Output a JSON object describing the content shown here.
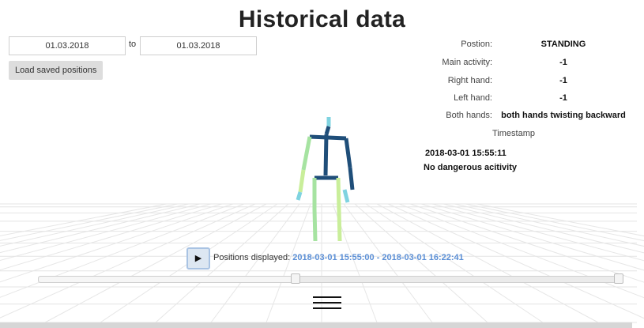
{
  "page": {
    "title": "Historical data"
  },
  "filters": {
    "date_from": "01.03.2018",
    "to_label": "to",
    "date_to": "01.03.2018",
    "load_button": "Load saved positions"
  },
  "info": {
    "rows": [
      {
        "label": "Postion:",
        "value": "STANDING"
      },
      {
        "label": "Main activity:",
        "value": "-1"
      },
      {
        "label": "Right hand:",
        "value": "-1"
      },
      {
        "label": "Left hand:",
        "value": "-1"
      },
      {
        "label": "Both hands:",
        "value": "both hands twisting backward"
      }
    ],
    "timestamp_label": "Timestamp",
    "timestamp_value": "2018-03-01 15:55:11",
    "danger_text": "No dangerous acitivity"
  },
  "playback": {
    "play_icon": "play-icon",
    "positions_label": "Positions displayed:",
    "positions_range": "2018-03-01 15:55:00 - 2018-03-01 16:22:41",
    "slider_position": 0.44
  },
  "menu": {
    "icon": "hamburger-menu-icon"
  },
  "colors": {
    "accent": "#5b8fd6",
    "skeleton_spine": "#1f4e79",
    "skeleton_light_blue": "#7fd3e0",
    "skeleton_green": "#a6e3a1",
    "skeleton_lime": "#c9ee9a"
  }
}
